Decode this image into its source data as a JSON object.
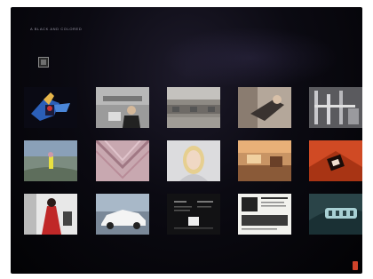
{
  "site": {
    "title": "A BLACK AND COLORED"
  },
  "logo": {
    "caption": ""
  },
  "gallery": {
    "thumbnails": [
      {
        "name": "thumb-blue-sculpture",
        "label": "blue sculpture"
      },
      {
        "name": "thumb-tablet-person",
        "label": "person with tablet"
      },
      {
        "name": "thumb-corridor",
        "label": "corridor"
      },
      {
        "name": "thumb-woman-reclining",
        "label": "reclining figure"
      },
      {
        "name": "thumb-metal-frames",
        "label": "metal frames"
      },
      {
        "name": "thumb-field-figure",
        "label": "figure in field"
      },
      {
        "name": "thumb-fabric-pattern",
        "label": "fabric"
      },
      {
        "name": "thumb-blonde-portrait",
        "label": "portrait"
      },
      {
        "name": "thumb-interior-orange",
        "label": "interior"
      },
      {
        "name": "thumb-red-installation",
        "label": "red installation"
      },
      {
        "name": "thumb-red-figure",
        "label": "red figure"
      },
      {
        "name": "thumb-white-car",
        "label": "car"
      },
      {
        "name": "thumb-dark-text",
        "label": "dark text piece"
      },
      {
        "name": "thumb-document-page",
        "label": "document"
      },
      {
        "name": "thumb-teal-lettering",
        "label": "lettering"
      }
    ]
  },
  "footer": {
    "text": ""
  },
  "colors": {
    "background": "#050409",
    "accent": "#d0432a"
  },
  "icons": {
    "logo": "logo-icon",
    "corner": "corner-icon"
  }
}
